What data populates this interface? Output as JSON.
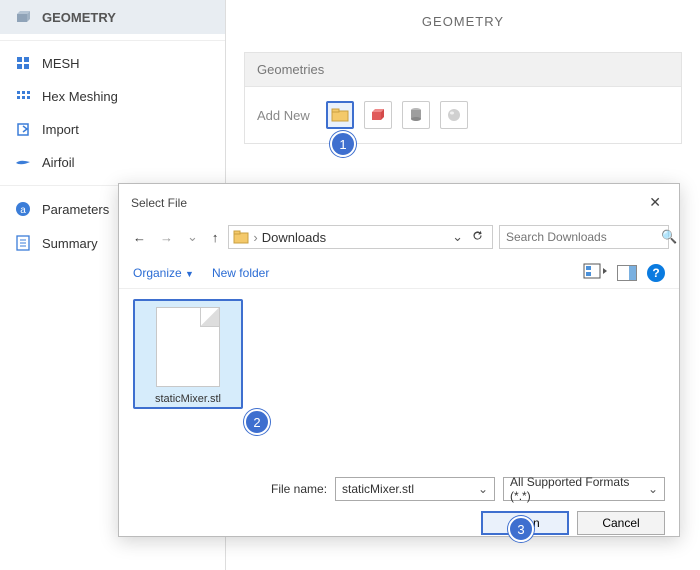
{
  "sidebar": {
    "items": [
      {
        "label": "GEOMETRY"
      },
      {
        "label": "MESH"
      },
      {
        "label": "Hex Meshing"
      },
      {
        "label": "Import"
      },
      {
        "label": "Airfoil"
      },
      {
        "label": "Parameters"
      },
      {
        "label": "Summary"
      }
    ]
  },
  "main": {
    "title": "GEOMETRY",
    "panel_header": "Geometries",
    "add_new_label": "Add New"
  },
  "dialog": {
    "title": "Select File",
    "path": "Downloads",
    "search_placeholder": "Search Downloads",
    "organize": "Organize",
    "new_folder": "New folder",
    "file": "staticMixer.stl",
    "file_name_label": "File name:",
    "file_name_value": "staticMixer.stl",
    "filter": "All Supported Formats (*.*)",
    "open": "Open",
    "cancel": "Cancel"
  },
  "badges": {
    "b1": "1",
    "b2": "2",
    "b3": "3"
  }
}
